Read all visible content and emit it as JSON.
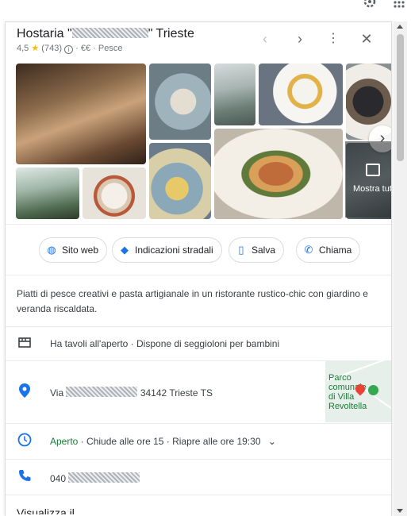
{
  "place": {
    "name_prefix": "Hostaria \"",
    "name_suffix": "\" Trieste",
    "rating": "4,5",
    "reviews": "(743)",
    "price": "€€",
    "category": "Pesce"
  },
  "gallery": {
    "more_photos_label": "Mostra tut"
  },
  "actions": [
    {
      "label": "Sito web",
      "icon": "globe-icon"
    },
    {
      "label": "Indicazioni stradali",
      "icon": "directions-icon"
    },
    {
      "label": "Salva",
      "icon": "bookmark-icon"
    },
    {
      "label": "Chiama",
      "icon": "phone-icon"
    }
  ],
  "description": "Piatti di pesce creativi e pasta artigianale in un ristorante rustico-chic con giardino e veranda riscaldata.",
  "amenities": "Ha tavoli all'aperto · Dispone di seggioloni per bambini",
  "address": {
    "prefix": "Via",
    "suffix": "34142 Trieste TS"
  },
  "map": {
    "label": "Parco\ncomunale\ndi Villa\nRevoltella"
  },
  "hours": {
    "status": "Aperto",
    "detail": " · Chiude alle ore 15 · Riapre alle ore 19:30"
  },
  "phone": {
    "prefix": "040"
  },
  "footer_cut": "Visualizza il..."
}
